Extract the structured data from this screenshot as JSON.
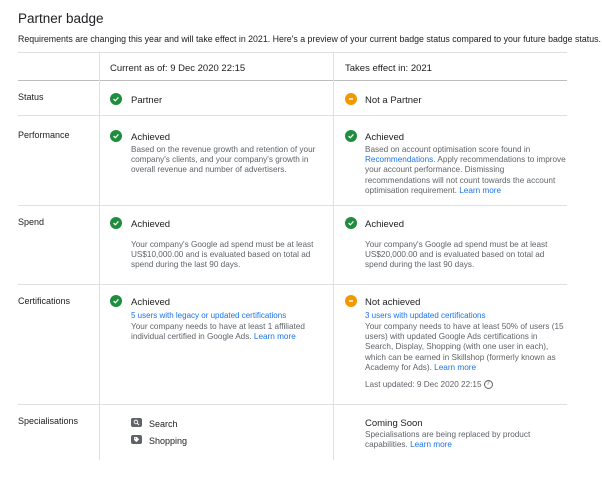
{
  "header": {
    "title": "Partner badge",
    "subtitle": "Requirements are changing this year and will take effect in 2021. Here's a preview of your current badge status compared to your future badge status."
  },
  "columns": {
    "current": "Current as of: 9 Dec 2020 22:15",
    "future": "Takes effect in: 2021"
  },
  "rows": {
    "status": {
      "label": "Status",
      "current_status": "Partner",
      "future_status": "Not a Partner"
    },
    "performance": {
      "label": "Performance",
      "current_status": "Achieved",
      "current_desc": "Based on the revenue growth and retention of your company's clients, and your company's growth in overall revenue and number of advertisers.",
      "future_status": "Achieved",
      "future_desc_1": "Based on account optimisation score found in",
      "future_link_1": "Recommendations",
      "future_desc_2": ". Apply recommendations to improve your account performance. Dismissing recommendations will not count towards the account optimisation requirement.",
      "future_link_2": "Learn more"
    },
    "spend": {
      "label": "Spend",
      "current_status": "Achieved",
      "current_desc": "Your company's Google ad spend must be at least US$10,000.00 and is evaluated based on total ad spend during the last 90 days.",
      "future_status": "Achieved",
      "future_desc": "Your company's Google ad spend must be at least US$20,000.00 and is evaluated based on total ad spend during the last 90 days."
    },
    "certifications": {
      "label": "Certifications",
      "current_status": "Achieved",
      "current_users_link": "5 users with legacy or updated certifications",
      "current_desc": "Your company needs to have at least 1 affiliated individual certified in Google Ads.",
      "current_learn_more": "Learn more",
      "future_status": "Not achieved",
      "future_users_link": "3 users with updated certifications",
      "future_desc": "Your company needs to have at least 50% of users (15 users) with updated Google Ads certifications in Search, Display, Shopping (with one user in each), which can be earned in Skillshop (formerly known as Academy for Ads).",
      "future_learn_more": "Learn more",
      "last_updated": "Last updated: 9 Dec 2020 22:15"
    },
    "specialisations": {
      "label": "Specialisations",
      "items": [
        "Search",
        "Shopping"
      ],
      "future_status": "Coming Soon",
      "future_desc": "Specialisations are being replaced by product capabilities.",
      "future_learn_more": "Learn more"
    }
  },
  "icons": {
    "achieved": "check-circle-icon",
    "not_achieved": "minus-circle-icon",
    "search": "search-icon",
    "shopping": "tag-icon",
    "info": "help-circle-icon"
  },
  "colors": {
    "green": "#1e8e3e",
    "orange": "#f29900",
    "link": "#1a73e8"
  }
}
